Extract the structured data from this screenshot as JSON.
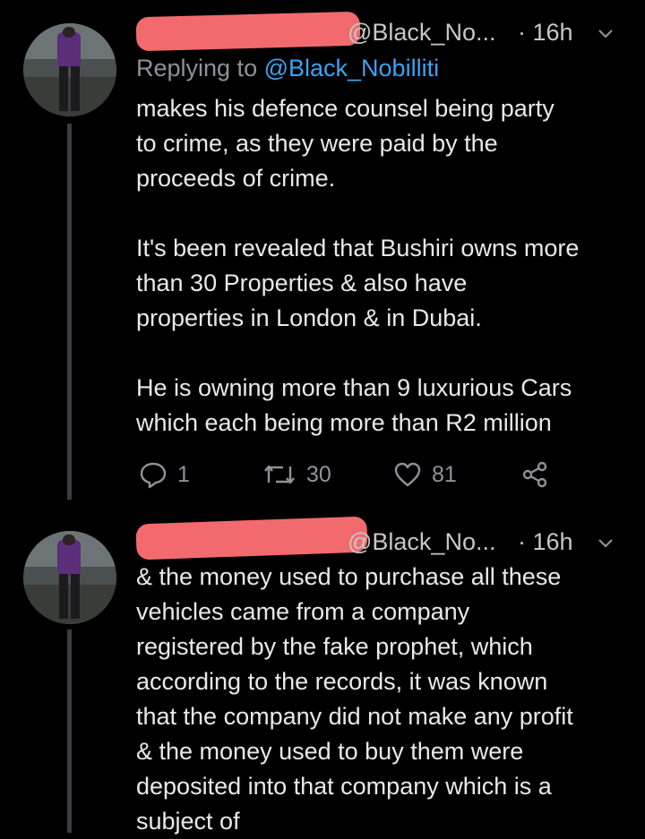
{
  "tweets": [
    {
      "handle": "@Black_No...",
      "time": "· 16h",
      "reply_prefix": "Replying to ",
      "reply_mention": "@Black_Nobilliti",
      "text": "makes his defence counsel being party\nto crime, as they were paid by the\nproceeds of crime.\n\nIt's been revealed that Bushiri owns more\nthan 30 Properties & also have\nproperties in London & in Dubai.\n\nHe is owning more than 9 luxurious Cars\nwhich each being more than R2 million",
      "reply_count": "1",
      "retweet_count": "30",
      "like_count": "81"
    },
    {
      "handle": "@Black_No...",
      "time": "· 16h",
      "text": "& the money used to purchase all these\nvehicles came from a company\nregistered by the fake prophet, which\naccording to the records, it was known\nthat the company did not make any profit\n& the money used to buy them were\ndeposited into that company which is a\nsubject of"
    }
  ],
  "icons": {
    "reply": "reply-icon",
    "retweet": "retweet-icon",
    "like": "heart-icon",
    "share": "share-icon",
    "caret": "chevron-down-icon"
  },
  "colors": {
    "background": "#000000",
    "text": "#e9e9e9",
    "muted": "#8e9399",
    "link": "#3aa3f2",
    "redaction": "#f26a6e"
  }
}
